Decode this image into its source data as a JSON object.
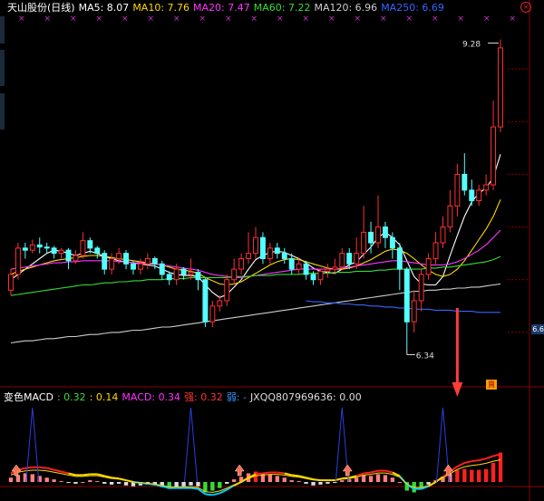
{
  "header": {
    "title": "天山股份(日线)",
    "ma": [
      {
        "label": "MA5: 8.07",
        "color": "#ffffff"
      },
      {
        "label": "MA10: 7.76",
        "color": "#ffd700"
      },
      {
        "label": "MA20: 7.47",
        "color": "#ff33ff"
      },
      {
        "label": "MA60: 7.22",
        "color": "#33dd33"
      },
      {
        "label": "MA120: 6.96",
        "color": "#cccccc"
      },
      {
        "label": "MA250: 6.69",
        "color": "#3366ff"
      }
    ],
    "close_icon": "close-circle-icon"
  },
  "price_panel": {
    "high_label": "9.28",
    "low_label": "6.34",
    "right_price": "6.6",
    "sell_badge": "賣"
  },
  "macd_header": {
    "title": "变色MACD",
    "values": [
      {
        "label": ": 0.32",
        "color": "#33dd33"
      },
      {
        "label": ": 0.14",
        "color": "#ffd700"
      },
      {
        "label": "MACD: 0.34",
        "color": "#ff33ff"
      },
      {
        "label": "强: 0.32",
        "color": "#ff3333"
      },
      {
        "label": "弱: -",
        "color": "#3399ff"
      },
      {
        "label": "JXQQ807969636: 0.00",
        "color": "#dddddd"
      }
    ]
  },
  "chart_data": {
    "type": "candlestick",
    "ylim": [
      6.0,
      9.5
    ],
    "candles": [
      [
        6.9,
        7.05,
        7.1,
        6.85
      ],
      [
        7.05,
        7.3,
        7.35,
        7.0
      ],
      [
        7.3,
        7.28,
        7.35,
        7.2
      ],
      [
        7.28,
        7.33,
        7.38,
        7.25
      ],
      [
        7.33,
        7.31,
        7.4,
        7.25
      ],
      [
        7.31,
        7.3,
        7.35,
        7.25
      ],
      [
        7.3,
        7.25,
        7.32,
        7.2
      ],
      [
        7.25,
        7.28,
        7.3,
        7.2
      ],
      [
        7.28,
        7.18,
        7.3,
        7.1
      ],
      [
        7.18,
        7.23,
        7.28,
        7.15
      ],
      [
        7.23,
        7.37,
        7.45,
        7.2
      ],
      [
        7.37,
        7.3,
        7.4,
        7.25
      ],
      [
        7.3,
        7.25,
        7.32,
        7.2
      ],
      [
        7.25,
        7.1,
        7.28,
        7.05
      ],
      [
        7.1,
        7.2,
        7.25,
        7.05
      ],
      [
        7.2,
        7.25,
        7.3,
        7.15
      ],
      [
        7.25,
        7.15,
        7.28,
        7.1
      ],
      [
        7.15,
        7.1,
        7.18,
        7.05
      ],
      [
        7.1,
        7.15,
        7.2,
        7.05
      ],
      [
        7.15,
        7.2,
        7.25,
        7.1
      ],
      [
        7.2,
        7.15,
        7.22,
        7.1
      ],
      [
        7.15,
        7.05,
        7.18,
        7.0
      ],
      [
        7.05,
        7.0,
        7.08,
        6.95
      ],
      [
        7.0,
        7.1,
        7.15,
        6.95
      ],
      [
        7.1,
        7.05,
        7.12,
        7.0
      ],
      [
        7.05,
        7.07,
        7.2,
        7.0
      ],
      [
        7.07,
        7.0,
        7.1,
        6.9
      ],
      [
        7.0,
        6.6,
        7.02,
        6.55
      ],
      [
        6.6,
        6.75,
        6.8,
        6.55
      ],
      [
        6.75,
        6.8,
        6.85,
        6.7
      ],
      [
        6.8,
        7.0,
        7.05,
        6.75
      ],
      [
        7.0,
        7.1,
        7.2,
        6.95
      ],
      [
        7.1,
        7.2,
        7.25,
        7.05
      ],
      [
        7.2,
        7.25,
        7.45,
        7.15
      ],
      [
        7.25,
        7.4,
        7.5,
        7.2
      ],
      [
        7.4,
        7.2,
        7.45,
        7.15
      ],
      [
        7.2,
        7.3,
        7.35,
        7.15
      ],
      [
        7.3,
        7.25,
        7.35,
        7.2
      ],
      [
        7.25,
        7.2,
        7.3,
        7.15
      ],
      [
        7.2,
        7.1,
        7.25,
        7.05
      ],
      [
        7.1,
        7.15,
        7.2,
        7.05
      ],
      [
        7.15,
        7.05,
        7.18,
        7.0
      ],
      [
        7.05,
        7.0,
        7.08,
        6.95
      ],
      [
        7.0,
        7.08,
        7.1,
        6.95
      ],
      [
        7.08,
        7.1,
        7.15,
        7.02
      ],
      [
        7.1,
        7.12,
        7.2,
        7.05
      ],
      [
        7.12,
        7.25,
        7.3,
        7.1
      ],
      [
        7.25,
        7.15,
        7.3,
        7.1
      ],
      [
        7.15,
        7.25,
        7.4,
        7.1
      ],
      [
        7.25,
        7.45,
        7.7,
        7.2
      ],
      [
        7.45,
        7.35,
        7.55,
        7.25
      ],
      [
        7.35,
        7.5,
        7.8,
        7.3
      ],
      [
        7.5,
        7.4,
        7.55,
        7.3
      ],
      [
        7.4,
        7.3,
        7.45,
        7.2
      ],
      [
        7.3,
        7.1,
        7.35,
        6.9
      ],
      [
        7.1,
        6.6,
        7.12,
        6.34
      ],
      [
        6.6,
        6.8,
        6.9,
        6.5
      ],
      [
        6.8,
        7.05,
        7.1,
        6.7
      ],
      [
        7.05,
        7.2,
        7.25,
        7.0
      ],
      [
        7.2,
        7.35,
        7.45,
        7.15
      ],
      [
        7.35,
        7.5,
        7.6,
        7.3
      ],
      [
        7.5,
        7.7,
        7.85,
        7.45
      ],
      [
        7.7,
        8.0,
        8.1,
        7.6
      ],
      [
        8.0,
        7.85,
        8.2,
        7.8
      ],
      [
        7.85,
        7.75,
        7.95,
        7.7
      ],
      [
        7.75,
        7.85,
        7.9,
        7.7
      ],
      [
        7.85,
        7.9,
        8.0,
        7.8
      ],
      [
        7.9,
        8.45,
        8.7,
        7.85
      ],
      [
        8.45,
        9.2,
        9.28,
        8.4
      ]
    ],
    "ma_series": [
      {
        "name": "MA5",
        "color": "#ffffff",
        "values": [
          7.0,
          7.05,
          7.1,
          7.15,
          7.2,
          7.25,
          7.28,
          7.27,
          7.25,
          7.23,
          7.25,
          7.27,
          7.25,
          7.22,
          7.2,
          7.18,
          7.17,
          7.16,
          7.15,
          7.14,
          7.13,
          7.1,
          7.07,
          7.05,
          7.04,
          7.04,
          7.03,
          6.95,
          6.88,
          6.83,
          6.86,
          6.93,
          7.0,
          7.1,
          7.19,
          7.23,
          7.26,
          7.27,
          7.26,
          7.23,
          7.2,
          7.16,
          7.11,
          7.08,
          7.07,
          7.06,
          7.1,
          7.14,
          7.17,
          7.24,
          7.31,
          7.4,
          7.45,
          7.4,
          7.33,
          7.18,
          7.03,
          6.96,
          6.95,
          6.95,
          7.03,
          7.23,
          7.42,
          7.6,
          7.74,
          7.82,
          7.87,
          7.97,
          8.19
        ]
      },
      {
        "name": "MA10",
        "color": "#ffd700",
        "values": [
          7.05,
          7.08,
          7.1,
          7.12,
          7.14,
          7.16,
          7.18,
          7.19,
          7.2,
          7.21,
          7.22,
          7.23,
          7.23,
          7.22,
          7.21,
          7.2,
          7.19,
          7.18,
          7.17,
          7.16,
          7.15,
          7.14,
          7.12,
          7.1,
          7.09,
          7.08,
          7.06,
          7.02,
          6.99,
          6.96,
          6.95,
          6.96,
          6.98,
          7.02,
          7.06,
          7.1,
          7.14,
          7.17,
          7.19,
          7.2,
          7.19,
          7.17,
          7.15,
          7.13,
          7.11,
          7.1,
          7.1,
          7.11,
          7.13,
          7.16,
          7.19,
          7.23,
          7.27,
          7.29,
          7.28,
          7.25,
          7.2,
          7.14,
          7.09,
          7.05,
          7.03,
          7.05,
          7.1,
          7.18,
          7.28,
          7.38,
          7.48,
          7.6,
          7.76
        ]
      },
      {
        "name": "MA20",
        "color": "#ff33ff",
        "values": [
          7.1,
          7.11,
          7.12,
          7.13,
          7.14,
          7.15,
          7.16,
          7.16,
          7.17,
          7.17,
          7.18,
          7.18,
          7.18,
          7.18,
          7.18,
          7.17,
          7.17,
          7.16,
          7.16,
          7.15,
          7.15,
          7.14,
          7.13,
          7.12,
          7.11,
          7.1,
          7.09,
          7.07,
          7.05,
          7.04,
          7.03,
          7.02,
          7.02,
          7.03,
          7.04,
          7.05,
          7.06,
          7.07,
          7.08,
          7.09,
          7.1,
          7.1,
          7.1,
          7.1,
          7.1,
          7.1,
          7.11,
          7.12,
          7.13,
          7.14,
          7.15,
          7.16,
          7.17,
          7.18,
          7.18,
          7.17,
          7.16,
          7.15,
          7.14,
          7.14,
          7.14,
          7.15,
          7.17,
          7.2,
          7.24,
          7.28,
          7.33,
          7.4,
          7.47
        ]
      },
      {
        "name": "MA60",
        "color": "#33dd33",
        "values": [
          6.85,
          6.86,
          6.87,
          6.88,
          6.89,
          6.9,
          6.91,
          6.92,
          6.93,
          6.94,
          6.95,
          6.95,
          6.96,
          6.97,
          6.97,
          6.98,
          6.98,
          6.99,
          6.99,
          7.0,
          7.0,
          7.0,
          7.01,
          7.01,
          7.01,
          7.02,
          7.02,
          7.02,
          7.02,
          7.02,
          7.02,
          7.03,
          7.03,
          7.03,
          7.04,
          7.04,
          7.04,
          7.05,
          7.05,
          7.05,
          7.05,
          7.06,
          7.06,
          7.06,
          7.06,
          7.07,
          7.07,
          7.07,
          7.08,
          7.08,
          7.08,
          7.09,
          7.09,
          7.1,
          7.1,
          7.1,
          7.1,
          7.1,
          7.11,
          7.11,
          7.12,
          7.12,
          7.13,
          7.14,
          7.15,
          7.16,
          7.17,
          7.19,
          7.22
        ]
      },
      {
        "name": "MA120",
        "color": "#cccccc",
        "values": [
          6.4,
          6.41,
          6.42,
          6.42,
          6.43,
          6.44,
          6.44,
          6.45,
          6.46,
          6.46,
          6.47,
          6.48,
          6.48,
          6.49,
          6.5,
          6.5,
          6.51,
          6.52,
          6.52,
          6.53,
          6.54,
          6.55,
          6.55,
          6.56,
          6.57,
          6.58,
          6.59,
          6.6,
          6.61,
          6.62,
          6.63,
          6.64,
          6.65,
          6.66,
          6.67,
          6.68,
          6.69,
          6.7,
          6.71,
          6.72,
          6.73,
          6.74,
          6.75,
          6.76,
          6.77,
          6.78,
          6.79,
          6.8,
          6.81,
          6.82,
          6.83,
          6.84,
          6.85,
          6.86,
          6.87,
          6.88,
          6.89,
          6.89,
          6.9,
          6.9,
          6.91,
          6.91,
          6.92,
          6.92,
          6.93,
          6.93,
          6.94,
          6.95,
          6.96
        ]
      },
      {
        "name": "MA250",
        "color": "#3366ff",
        "values": [
          null,
          null,
          null,
          null,
          null,
          null,
          null,
          null,
          null,
          null,
          null,
          null,
          null,
          null,
          null,
          null,
          null,
          null,
          null,
          null,
          null,
          null,
          null,
          null,
          null,
          null,
          null,
          null,
          null,
          null,
          null,
          null,
          null,
          null,
          null,
          null,
          null,
          null,
          null,
          null,
          null,
          6.8,
          6.79,
          6.79,
          6.78,
          6.78,
          6.77,
          6.77,
          6.76,
          6.76,
          6.75,
          6.75,
          6.74,
          6.74,
          6.73,
          6.73,
          6.72,
          6.72,
          6.72,
          6.71,
          6.71,
          6.71,
          6.7,
          6.7,
          6.7,
          6.69,
          6.69,
          6.69,
          6.69
        ]
      }
    ],
    "macd": {
      "ylim": [
        -0.9,
        0.9
      ],
      "hist": [
        0.05,
        0.08,
        0.1,
        0.09,
        0.07,
        0.05,
        0.03,
        0.01,
        -0.01,
        -0.02,
        0.0,
        0.02,
        0.01,
        -0.02,
        -0.03,
        -0.02,
        -0.04,
        -0.05,
        -0.04,
        -0.03,
        -0.04,
        -0.06,
        -0.08,
        -0.06,
        -0.05,
        -0.04,
        -0.05,
        -0.12,
        -0.1,
        -0.07,
        -0.02,
        0.03,
        0.06,
        0.1,
        0.12,
        0.1,
        0.09,
        0.07,
        0.05,
        0.02,
        0.01,
        -0.02,
        -0.04,
        -0.03,
        -0.02,
        -0.01,
        0.02,
        0.03,
        0.05,
        0.08,
        0.07,
        0.09,
        0.08,
        0.05,
        0.0,
        -0.1,
        -0.12,
        -0.08,
        -0.03,
        0.02,
        0.06,
        0.1,
        0.14,
        0.15,
        0.14,
        0.14,
        0.15,
        0.22,
        0.34
      ],
      "dif": [
        0.1,
        0.14,
        0.16,
        0.17,
        0.17,
        0.16,
        0.14,
        0.12,
        0.1,
        0.08,
        0.08,
        0.09,
        0.09,
        0.07,
        0.05,
        0.04,
        0.02,
        0.0,
        -0.01,
        -0.02,
        -0.03,
        -0.05,
        -0.07,
        -0.07,
        -0.07,
        -0.07,
        -0.08,
        -0.14,
        -0.15,
        -0.13,
        -0.09,
        -0.04,
        0.0,
        0.05,
        0.09,
        0.1,
        0.11,
        0.11,
        0.1,
        0.08,
        0.07,
        0.05,
        0.03,
        0.02,
        0.02,
        0.02,
        0.04,
        0.05,
        0.07,
        0.1,
        0.11,
        0.13,
        0.13,
        0.11,
        0.07,
        -0.03,
        -0.08,
        -0.08,
        -0.05,
        0.0,
        0.06,
        0.12,
        0.18,
        0.22,
        0.24,
        0.25,
        0.27,
        0.3,
        0.32
      ],
      "spikes": [
        3,
        25,
        46,
        60
      ],
      "arrows": [
        0,
        31,
        46,
        60
      ]
    }
  }
}
